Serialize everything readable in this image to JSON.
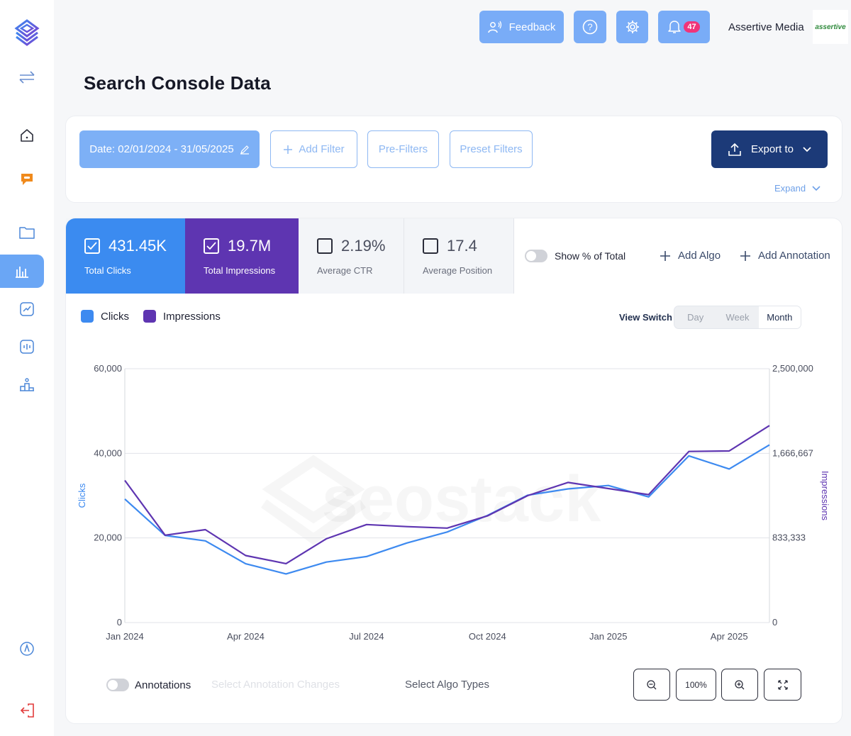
{
  "header": {
    "feedback_label": "Feedback",
    "notification_count": "47",
    "org_name": "Assertive Media",
    "org_logo_text": "assertive"
  },
  "page": {
    "title": "Search Console Data"
  },
  "filters": {
    "date_label": "Date: 02/01/2024 - 31/05/2025",
    "add_filter": "Add Filter",
    "pre_filters": "Pre-Filters",
    "preset_filters": "Preset Filters",
    "export_label": "Export to",
    "expand_label": "Expand"
  },
  "metrics": [
    {
      "value": "431.45K",
      "label": "Total Clicks",
      "checked": true,
      "color": "#3b8bf0"
    },
    {
      "value": "19.7M",
      "label": "Total Impressions",
      "checked": true,
      "color": "#5e35b1"
    },
    {
      "value": "2.19%",
      "label": "Average CTR",
      "checked": false
    },
    {
      "value": "17.4",
      "label": "Average Position",
      "checked": false
    }
  ],
  "tools": {
    "show_pct": "Show % of Total",
    "add_algo": "Add Algo",
    "add_annotation": "Add Annotation"
  },
  "view_switch": {
    "label": "View Switch",
    "options": [
      "Day",
      "Week",
      "Month"
    ],
    "selected": "Month"
  },
  "chart_data": {
    "type": "line",
    "x": [
      "Jan 2024",
      "Feb 2024",
      "Mar 2024",
      "Apr 2024",
      "May 2024",
      "Jun 2024",
      "Jul 2024",
      "Aug 2024",
      "Sep 2024",
      "Oct 2024",
      "Nov 2024",
      "Dec 2024",
      "Jan 2025",
      "Feb 2025",
      "Mar 2025",
      "Apr 2025",
      "May 2025"
    ],
    "x_ticks": [
      "Jan 2024",
      "Apr 2024",
      "Jul 2024",
      "Oct 2024",
      "Jan 2025",
      "Apr 2025"
    ],
    "series": [
      {
        "name": "Clicks",
        "axis": "left",
        "color": "#3d8af0",
        "values": [
          29200,
          20600,
          19300,
          13900,
          11500,
          14300,
          15600,
          18800,
          21400,
          25300,
          30100,
          31600,
          32400,
          29700,
          39400,
          36300,
          42000
        ]
      },
      {
        "name": "Impressions",
        "axis": "right",
        "color": "#5e35b1",
        "values": [
          1400000,
          860000,
          915000,
          660000,
          580000,
          825000,
          965000,
          945000,
          930000,
          1050000,
          1250000,
          1380000,
          1320000,
          1260000,
          1685000,
          1690000,
          1940000
        ]
      }
    ],
    "ylabel_left": "Clicks",
    "ylabel_right": "Impressions",
    "ylim_left": [
      0,
      60000
    ],
    "ylim_right": [
      0,
      2500000
    ],
    "yticks_left": [
      "0",
      "20,000",
      "40,000",
      "60,000"
    ],
    "yticks_right": [
      "0",
      "833,333",
      "1,666,667",
      "2,500,000"
    ],
    "watermark": "seostack",
    "grid": true
  },
  "bottom": {
    "annotations_label": "Annotations",
    "annotation_changes_placeholder": "Select Annotation Changes",
    "algo_types_placeholder": "Select Algo Types",
    "zoom_reset": "100%"
  }
}
